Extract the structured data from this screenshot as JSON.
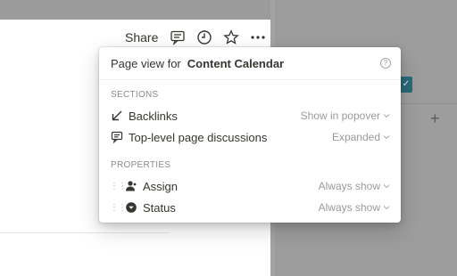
{
  "toolbar": {
    "share_label": "Share",
    "icons": [
      "comment-icon",
      "clock-icon",
      "star-icon",
      "more-icon"
    ]
  },
  "popover": {
    "header_prefix": "Page view for",
    "page_name": "Content Calendar",
    "help_glyph": "?",
    "sections_title": "SECTIONS",
    "sections": [
      {
        "label": "Backlinks",
        "value": "Show in popover",
        "icon": "backlink-arrow-icon"
      },
      {
        "label": "Top-level page discussions",
        "value": "Expanded",
        "icon": "comment-icon"
      }
    ],
    "properties_title": "PROPERTIES",
    "properties": [
      {
        "label": "Assign",
        "value": "Always show",
        "icon": "person-icon"
      },
      {
        "label": "Status",
        "value": "Always show",
        "icon": "status-icon"
      }
    ]
  },
  "side": {
    "check": "✓",
    "plus": "+"
  },
  "colors": {
    "accent": "#2b6a78",
    "overlay": "#9b9b9b"
  }
}
